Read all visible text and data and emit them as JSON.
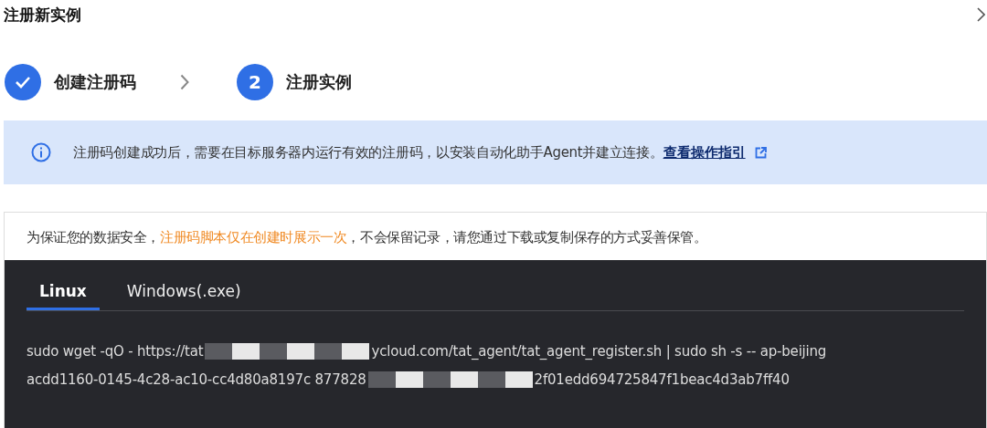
{
  "title": "注册新实例",
  "steps": [
    {
      "label": "创建注册码",
      "done": true
    },
    {
      "number": "2",
      "label": "注册实例",
      "done": false
    }
  ],
  "info": {
    "text": "注册码创建成功后，需要在目标服务器内运行有效的注册码，以安装自动化助手Agent并建立连接。",
    "link": "查看操作指引"
  },
  "notice": "为保证您的数据安全，**注册码脚本仅在创建时展示一次**，不会保留记录，请您通过下载或复制保存的方式妥善保管。",
  "code_tabs": [
    {
      "label": "Linux",
      "selected": true
    },
    {
      "label": "Windows(.exe)",
      "selected": false
    }
  ],
  "code_lines": [
    {
      "parts": [
        "sudo wget -qO - https://tat",
        "ycloud.com/tat_agent/tat_agent_register.sh | sudo sh -s -- ap-beijing"
      ]
    },
    {
      "parts": [
        "acdd1160-0145-4c28-ac10-cc4d80a8197c 877828",
        "2f01edd694725847f1beac4d3ab7ff40"
      ]
    }
  ]
}
